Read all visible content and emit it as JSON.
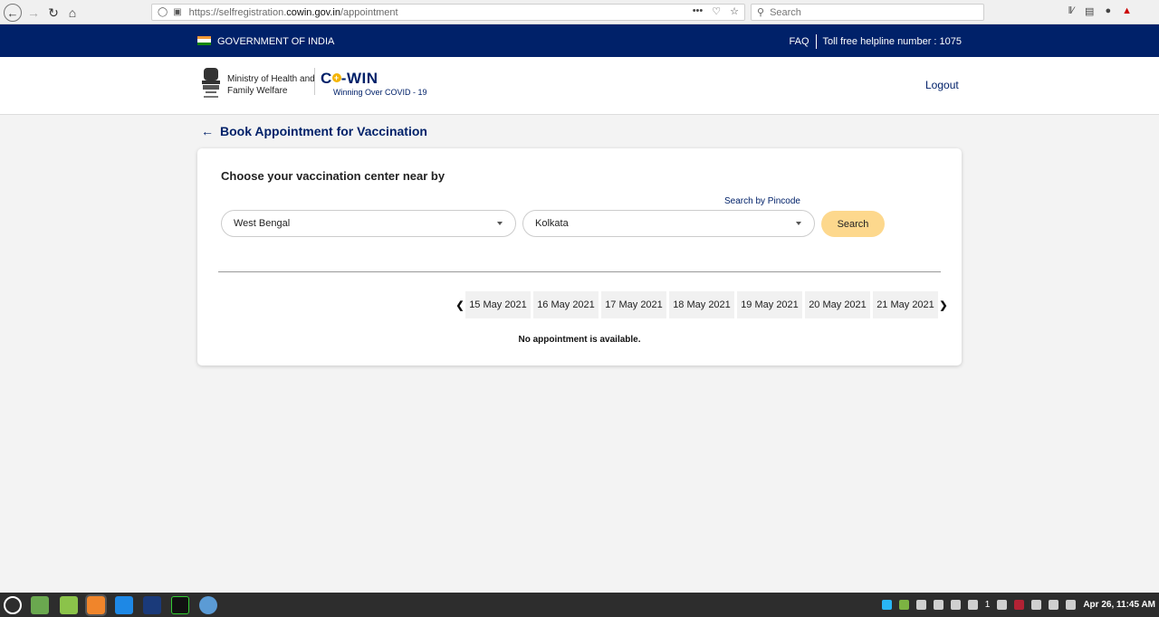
{
  "browser": {
    "url_prefix": "https://selfregistration.",
    "url_domain": "cowin.gov.in",
    "url_path": "/appointment",
    "search_placeholder": "Search",
    "more_label": "•••"
  },
  "gov_bar": {
    "label": "GOVERNMENT OF INDIA",
    "faq": "FAQ",
    "helpline": "Toll free helpline number : 1075"
  },
  "header": {
    "ministry_line1": "Ministry of Health and",
    "ministry_line2": "Family Welfare",
    "logo_text_a": "C",
    "logo_text_b": "-WIN",
    "tagline": "Winning Over COVID - 19",
    "logout": "Logout"
  },
  "page": {
    "title": "Book Appointment for Vaccination",
    "heading": "Choose your vaccination center near by",
    "pincode_link": "Search by Pincode",
    "state_value": "West Bengal",
    "district_value": "Kolkata",
    "search_button": "Search",
    "dates": [
      "15 May 2021",
      "16 May 2021",
      "17 May 2021",
      "18 May 2021",
      "19 May 2021",
      "20 May 2021",
      "21 May 2021"
    ],
    "no_appointment": "No appointment is available."
  },
  "taskbar": {
    "clock": "Apr 26, 11:45 AM",
    "workspace": "1"
  },
  "colors": {
    "navy": "#002169",
    "search_button": "#fdd88d",
    "taskbar": "#2d2d2d"
  }
}
